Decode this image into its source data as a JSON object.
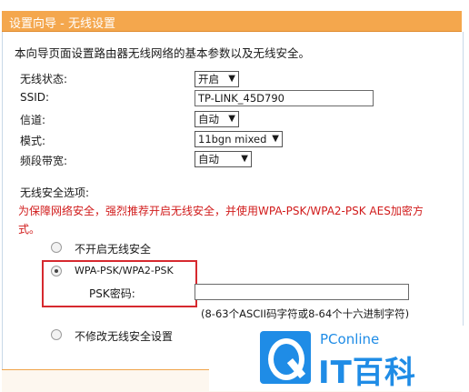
{
  "title": "设置向导 - 无线设置",
  "intro": "本向导页面设置路由器无线网络的基本参数以及无线安全。",
  "fields": {
    "wireless_state": {
      "label": "无线状态:",
      "value": "开启"
    },
    "ssid": {
      "label": "SSID:",
      "value": "TP-LINK_45D790"
    },
    "channel": {
      "label": "信道:",
      "value": "自动"
    },
    "mode": {
      "label": "模式:",
      "value": "11bgn mixed"
    },
    "bandwidth": {
      "label": "频段带宽:",
      "value": "自动"
    }
  },
  "security": {
    "heading": "无线安全选项:",
    "warning_line1": "为保障网络安全，强烈推荐开启无线安全，并使用WPA-PSK/WPA2-PSK AES加密方",
    "warning_line2": "式。",
    "option_off": "不开启无线安全",
    "option_wpa": "WPA-PSK/WPA2-PSK",
    "psk_label": "PSK密码:",
    "psk_value": "",
    "psk_hint": "(8-63个ASCII码字符或8-64个十六进制字符)",
    "option_keep": "不修改无线安全设置",
    "selected": "WPA-PSK/WPA2-PSK"
  },
  "watermark": {
    "small": "PConline",
    "name": "IT百科"
  },
  "colors": {
    "titlebar": "#f4a74d",
    "warning": "#d11b1b",
    "highlight_box": "#d6292f",
    "brand_blue": "#1f8ce6"
  },
  "icons": [
    "chevron-down-icon",
    "radio-icon",
    "pconline-logo-icon"
  ]
}
